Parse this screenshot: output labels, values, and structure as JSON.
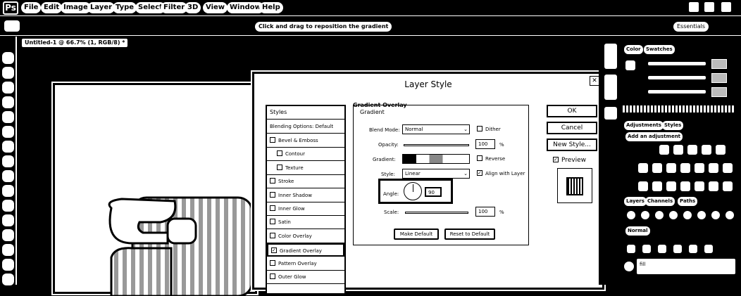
{
  "app": {
    "logo": "Ps"
  },
  "menu": {
    "items": [
      "File",
      "Edit",
      "Image",
      "Layer",
      "Type",
      "Select",
      "Filter",
      "3D",
      "View",
      "Window",
      "Help"
    ]
  },
  "options_bar": {
    "hint": "Click and drag to reposition the gradient",
    "workspace": "Essentials"
  },
  "document": {
    "tab_label": "Untitled-1 @ 66.7% (1, RGB/8) *"
  },
  "dialog": {
    "title": "Layer Style",
    "styles_header": "Styles",
    "blending_options": "Blending Options: Default",
    "style_items": [
      {
        "label": "Bevel & Emboss",
        "checked": false
      },
      {
        "label": "Contour",
        "checked": false
      },
      {
        "label": "Texture",
        "checked": false
      },
      {
        "label": "Stroke",
        "checked": false
      },
      {
        "label": "Inner Shadow",
        "checked": false
      },
      {
        "label": "Inner Glow",
        "checked": false
      },
      {
        "label": "Satin",
        "checked": false
      },
      {
        "label": "Color Overlay",
        "checked": false
      },
      {
        "label": "Gradient Overlay",
        "checked": true
      },
      {
        "label": "Pattern Overlay",
        "checked": false
      },
      {
        "label": "Outer Glow",
        "checked": false
      }
    ],
    "section_title": "Gradient Overlay",
    "group_title": "Gradient",
    "blend_mode_label": "Blend Mode:",
    "blend_mode_value": "Normal",
    "dither_label": "Dither",
    "opacity_label": "Opacity:",
    "opacity_value": "100",
    "percent": "%",
    "gradient_label": "Gradient:",
    "reverse_label": "Reverse",
    "style_label": "Style:",
    "style_value": "Linear",
    "align_label": "Align with Layer",
    "angle_label": "Angle:",
    "angle_value": "90",
    "scale_label": "Scale:",
    "scale_value": "100",
    "make_default": "Make Default",
    "reset_default": "Reset to Default",
    "ok": "OK",
    "cancel": "Cancel",
    "new_style": "New Style...",
    "preview_label": "Preview"
  },
  "panels": {
    "color_tab": "Color",
    "swatches_tab": "Swatches",
    "adjustments_tab": "Adjustments",
    "styles_tab": "Styles",
    "add_adjustment": "Add an adjustment",
    "layers_tab": "Layers",
    "channels_tab": "Channels",
    "paths_tab": "Paths",
    "blend": "Normal",
    "layer_name": "fill"
  }
}
